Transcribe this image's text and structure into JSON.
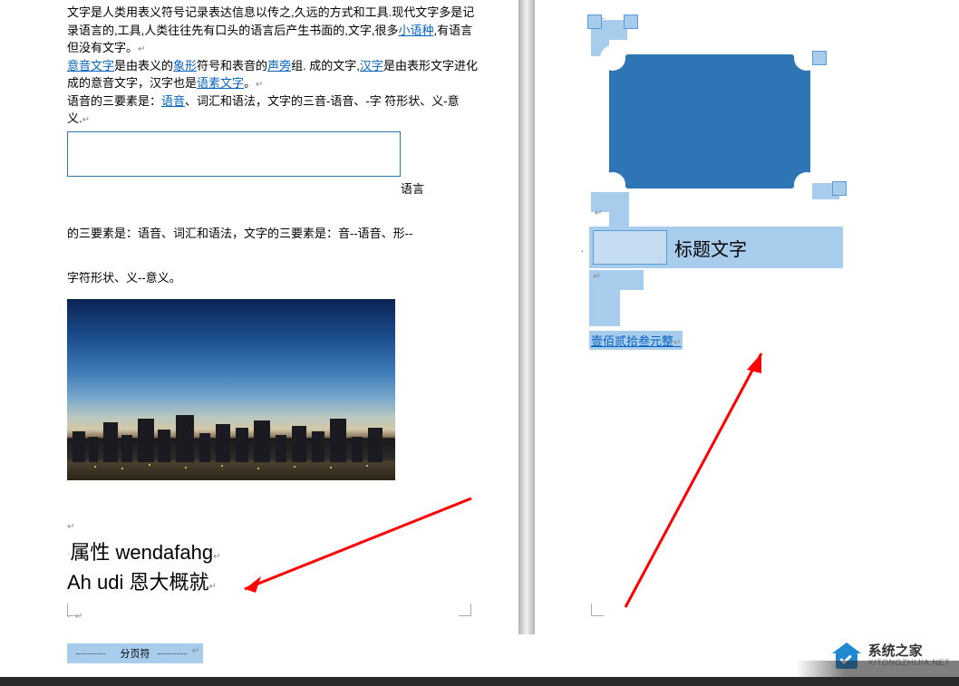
{
  "leftPage": {
    "para1_a": "文字是人类用表义符号记录表达信息以传之,久远的方式和工具.现代文字多是记录语言的,工具,人类往往先有口头的语言后产生书面的,文字,很多",
    "link_small": "小语种",
    "para1_b": ",有语言但没有文字。",
    "link_yinyi": "意音文字",
    "para2_a": "是由表义的",
    "link_xiangxing": "象形",
    "para2_b": "符号和表音的",
    "link_shengpang": "声旁",
    "para2_c": "组. 成的文字,",
    "link_hanzi": "汉字",
    "para2_d": "是由表形文字进化成的意音文字，汉字也是",
    "link_yusuo": "语素文字",
    "para2_e": "。",
    "para3_a": "语音的三要素是：",
    "link_yuyin": "语音",
    "para3_b": "、词汇和语法，文字的三音-语音、-字 符形状、义-意义.",
    "after_frame_label": "语言",
    "para4": "的三要素是：语音、词汇和语法，文字的三要素是：音--语音、形--",
    "para5": "字符形状、义--意义。",
    "heading1": "属性 wendafahg",
    "heading2": "Ah udi 恩大概就",
    "page_break": "分页符"
  },
  "rightPage": {
    "title_text": "标题文字",
    "amount": "壹佰贰拾叁元整"
  },
  "watermark": {
    "cn": "系统之家",
    "en": "XITONGZHIJIA.NET"
  }
}
